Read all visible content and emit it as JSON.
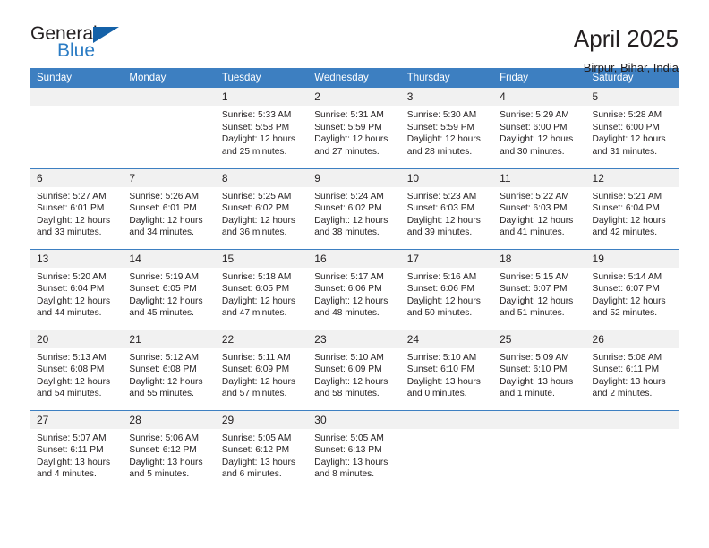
{
  "brand": {
    "name_part1": "General",
    "name_part2": "Blue",
    "triangle_icon": "triangle-icon",
    "accent_color": "#2b7cc4",
    "triangle_color": "#1461a8"
  },
  "header": {
    "title": "April 2025",
    "location": "Birpur, Bihar, India"
  },
  "calendar": {
    "header_bg": "#3d7fc1",
    "daynum_bg": "#f1f1f1",
    "weekday_headers": [
      "Sunday",
      "Monday",
      "Tuesday",
      "Wednesday",
      "Thursday",
      "Friday",
      "Saturday"
    ],
    "weeks": [
      [
        {
          "day": "",
          "empty": true
        },
        {
          "day": "",
          "empty": true
        },
        {
          "day": "1",
          "sunrise": "Sunrise: 5:33 AM",
          "sunset": "Sunset: 5:58 PM",
          "daylight_line1": "Daylight: 12 hours",
          "daylight_line2": "and 25 minutes."
        },
        {
          "day": "2",
          "sunrise": "Sunrise: 5:31 AM",
          "sunset": "Sunset: 5:59 PM",
          "daylight_line1": "Daylight: 12 hours",
          "daylight_line2": "and 27 minutes."
        },
        {
          "day": "3",
          "sunrise": "Sunrise: 5:30 AM",
          "sunset": "Sunset: 5:59 PM",
          "daylight_line1": "Daylight: 12 hours",
          "daylight_line2": "and 28 minutes."
        },
        {
          "day": "4",
          "sunrise": "Sunrise: 5:29 AM",
          "sunset": "Sunset: 6:00 PM",
          "daylight_line1": "Daylight: 12 hours",
          "daylight_line2": "and 30 minutes."
        },
        {
          "day": "5",
          "sunrise": "Sunrise: 5:28 AM",
          "sunset": "Sunset: 6:00 PM",
          "daylight_line1": "Daylight: 12 hours",
          "daylight_line2": "and 31 minutes."
        }
      ],
      [
        {
          "day": "6",
          "sunrise": "Sunrise: 5:27 AM",
          "sunset": "Sunset: 6:01 PM",
          "daylight_line1": "Daylight: 12 hours",
          "daylight_line2": "and 33 minutes."
        },
        {
          "day": "7",
          "sunrise": "Sunrise: 5:26 AM",
          "sunset": "Sunset: 6:01 PM",
          "daylight_line1": "Daylight: 12 hours",
          "daylight_line2": "and 34 minutes."
        },
        {
          "day": "8",
          "sunrise": "Sunrise: 5:25 AM",
          "sunset": "Sunset: 6:02 PM",
          "daylight_line1": "Daylight: 12 hours",
          "daylight_line2": "and 36 minutes."
        },
        {
          "day": "9",
          "sunrise": "Sunrise: 5:24 AM",
          "sunset": "Sunset: 6:02 PM",
          "daylight_line1": "Daylight: 12 hours",
          "daylight_line2": "and 38 minutes."
        },
        {
          "day": "10",
          "sunrise": "Sunrise: 5:23 AM",
          "sunset": "Sunset: 6:03 PM",
          "daylight_line1": "Daylight: 12 hours",
          "daylight_line2": "and 39 minutes."
        },
        {
          "day": "11",
          "sunrise": "Sunrise: 5:22 AM",
          "sunset": "Sunset: 6:03 PM",
          "daylight_line1": "Daylight: 12 hours",
          "daylight_line2": "and 41 minutes."
        },
        {
          "day": "12",
          "sunrise": "Sunrise: 5:21 AM",
          "sunset": "Sunset: 6:04 PM",
          "daylight_line1": "Daylight: 12 hours",
          "daylight_line2": "and 42 minutes."
        }
      ],
      [
        {
          "day": "13",
          "sunrise": "Sunrise: 5:20 AM",
          "sunset": "Sunset: 6:04 PM",
          "daylight_line1": "Daylight: 12 hours",
          "daylight_line2": "and 44 minutes."
        },
        {
          "day": "14",
          "sunrise": "Sunrise: 5:19 AM",
          "sunset": "Sunset: 6:05 PM",
          "daylight_line1": "Daylight: 12 hours",
          "daylight_line2": "and 45 minutes."
        },
        {
          "day": "15",
          "sunrise": "Sunrise: 5:18 AM",
          "sunset": "Sunset: 6:05 PM",
          "daylight_line1": "Daylight: 12 hours",
          "daylight_line2": "and 47 minutes."
        },
        {
          "day": "16",
          "sunrise": "Sunrise: 5:17 AM",
          "sunset": "Sunset: 6:06 PM",
          "daylight_line1": "Daylight: 12 hours",
          "daylight_line2": "and 48 minutes."
        },
        {
          "day": "17",
          "sunrise": "Sunrise: 5:16 AM",
          "sunset": "Sunset: 6:06 PM",
          "daylight_line1": "Daylight: 12 hours",
          "daylight_line2": "and 50 minutes."
        },
        {
          "day": "18",
          "sunrise": "Sunrise: 5:15 AM",
          "sunset": "Sunset: 6:07 PM",
          "daylight_line1": "Daylight: 12 hours",
          "daylight_line2": "and 51 minutes."
        },
        {
          "day": "19",
          "sunrise": "Sunrise: 5:14 AM",
          "sunset": "Sunset: 6:07 PM",
          "daylight_line1": "Daylight: 12 hours",
          "daylight_line2": "and 52 minutes."
        }
      ],
      [
        {
          "day": "20",
          "sunrise": "Sunrise: 5:13 AM",
          "sunset": "Sunset: 6:08 PM",
          "daylight_line1": "Daylight: 12 hours",
          "daylight_line2": "and 54 minutes."
        },
        {
          "day": "21",
          "sunrise": "Sunrise: 5:12 AM",
          "sunset": "Sunset: 6:08 PM",
          "daylight_line1": "Daylight: 12 hours",
          "daylight_line2": "and 55 minutes."
        },
        {
          "day": "22",
          "sunrise": "Sunrise: 5:11 AM",
          "sunset": "Sunset: 6:09 PM",
          "daylight_line1": "Daylight: 12 hours",
          "daylight_line2": "and 57 minutes."
        },
        {
          "day": "23",
          "sunrise": "Sunrise: 5:10 AM",
          "sunset": "Sunset: 6:09 PM",
          "daylight_line1": "Daylight: 12 hours",
          "daylight_line2": "and 58 minutes."
        },
        {
          "day": "24",
          "sunrise": "Sunrise: 5:10 AM",
          "sunset": "Sunset: 6:10 PM",
          "daylight_line1": "Daylight: 13 hours",
          "daylight_line2": "and 0 minutes."
        },
        {
          "day": "25",
          "sunrise": "Sunrise: 5:09 AM",
          "sunset": "Sunset: 6:10 PM",
          "daylight_line1": "Daylight: 13 hours",
          "daylight_line2": "and 1 minute."
        },
        {
          "day": "26",
          "sunrise": "Sunrise: 5:08 AM",
          "sunset": "Sunset: 6:11 PM",
          "daylight_line1": "Daylight: 13 hours",
          "daylight_line2": "and 2 minutes."
        }
      ],
      [
        {
          "day": "27",
          "sunrise": "Sunrise: 5:07 AM",
          "sunset": "Sunset: 6:11 PM",
          "daylight_line1": "Daylight: 13 hours",
          "daylight_line2": "and 4 minutes."
        },
        {
          "day": "28",
          "sunrise": "Sunrise: 5:06 AM",
          "sunset": "Sunset: 6:12 PM",
          "daylight_line1": "Daylight: 13 hours",
          "daylight_line2": "and 5 minutes."
        },
        {
          "day": "29",
          "sunrise": "Sunrise: 5:05 AM",
          "sunset": "Sunset: 6:12 PM",
          "daylight_line1": "Daylight: 13 hours",
          "daylight_line2": "and 6 minutes."
        },
        {
          "day": "30",
          "sunrise": "Sunrise: 5:05 AM",
          "sunset": "Sunset: 6:13 PM",
          "daylight_line1": "Daylight: 13 hours",
          "daylight_line2": "and 8 minutes."
        },
        {
          "day": "",
          "empty": true
        },
        {
          "day": "",
          "empty": true
        },
        {
          "day": "",
          "empty": true
        }
      ]
    ]
  }
}
